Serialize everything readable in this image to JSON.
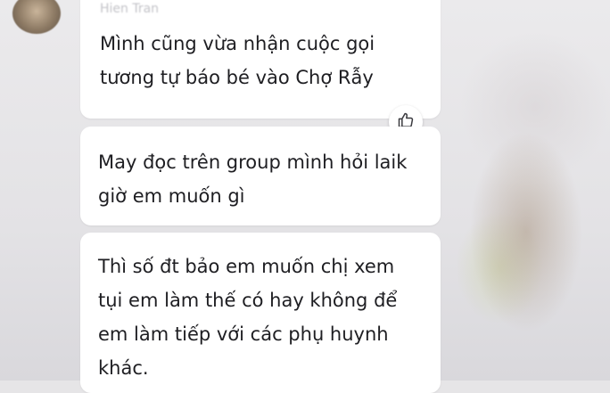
{
  "messages": [
    {
      "sender": "Hien Tran",
      "lines": [
        "Mình cũng vừa nhận cuộc gọi",
        "tương tự báo bé vào Chợ Rẫy"
      ]
    },
    {
      "lines": [
        "May đọc trên group mình hỏi laik",
        "giờ em muốn gì"
      ]
    },
    {
      "lines": [
        "Thì số đt bảo em muốn chị xem",
        "tụi em làm thế có hay không để",
        "em làm tiếp với các phụ huynh",
        "khác."
      ]
    }
  ],
  "reaction": {
    "icon": "thumbs-up-icon"
  },
  "colors": {
    "bubble": "#ffffff",
    "text": "#1e1e22",
    "background": "#e6e5e7"
  }
}
